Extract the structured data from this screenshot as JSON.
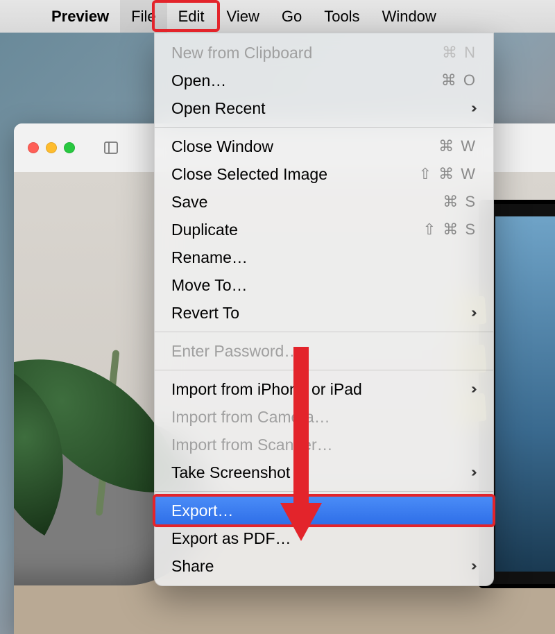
{
  "menubar": {
    "app": "Preview",
    "items": [
      "File",
      "Edit",
      "View",
      "Go",
      "Tools",
      "Window"
    ],
    "active": "File"
  },
  "dropdown": {
    "groups": [
      [
        {
          "label": "New from Clipboard",
          "shortcut": "⌘ N",
          "disabled": true
        },
        {
          "label": "Open…",
          "shortcut": "⌘ O"
        },
        {
          "label": "Open Recent",
          "submenu": true
        }
      ],
      [
        {
          "label": "Close Window",
          "shortcut": "⌘ W"
        },
        {
          "label": "Close Selected Image",
          "shortcut": "⇧ ⌘ W"
        },
        {
          "label": "Save",
          "shortcut": "⌘ S"
        },
        {
          "label": "Duplicate",
          "shortcut": "⇧ ⌘ S"
        },
        {
          "label": "Rename…"
        },
        {
          "label": "Move To…"
        },
        {
          "label": "Revert To",
          "submenu": true
        }
      ],
      [
        {
          "label": "Enter Password…",
          "disabled": true
        }
      ],
      [
        {
          "label": "Import from iPhone or iPad",
          "submenu": true
        },
        {
          "label": "Import from Camera…",
          "disabled": true
        },
        {
          "label": "Import from Scanner…",
          "disabled": true
        },
        {
          "label": "Take Screenshot",
          "submenu": true
        }
      ],
      [
        {
          "label": "Export…",
          "selected": true
        },
        {
          "label": "Export as PDF…"
        },
        {
          "label": "Share",
          "submenu": true
        }
      ]
    ]
  },
  "annotations": {
    "highlight_menu": "File",
    "highlight_item": "Export…"
  }
}
